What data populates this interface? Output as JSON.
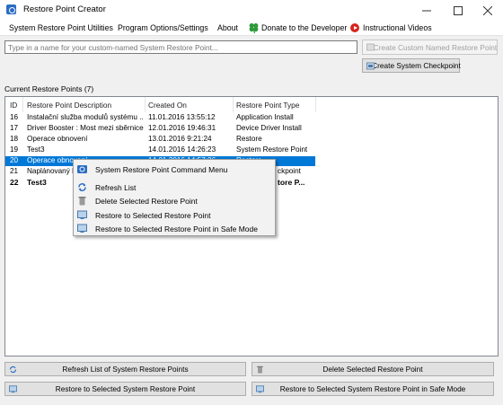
{
  "window": {
    "title": "Restore Point Creator"
  },
  "menu": {
    "utilities": "System Restore Point Utilities",
    "options": "Program Options/Settings",
    "about": "About",
    "donate": "Donate to the Developer",
    "videos": "Instructional Videos"
  },
  "name_input": {
    "placeholder": "Type in a name for your custom-named System Restore Point...",
    "value": ""
  },
  "buttons": {
    "create_custom": "Create Custom Named Restore Point",
    "create_checkpoint": "Create System Checkpoint",
    "refresh_list": "Refresh List of System Restore Points",
    "delete_selected": "Delete Selected Restore Point",
    "restore_selected": "Restore to Selected System Restore Point",
    "restore_safe_mode": "Restore to Selected System Restore Point in Safe Mode"
  },
  "list": {
    "label": "Current Restore Points (7)",
    "columns": [
      "ID",
      "Restore Point Description",
      "Created On",
      "Restore Point Type"
    ],
    "rows": [
      {
        "id": "16",
        "desc": "Instalační služba modulů systému ...",
        "created": "11.01.2016 13:55:12",
        "type": "Application Install"
      },
      {
        "id": "17",
        "desc": "Driver Booster : Most mezi sběrnice...",
        "created": "12.01.2016 19:46:31",
        "type": "Device Driver Install"
      },
      {
        "id": "18",
        "desc": "Operace obnovení",
        "created": "13.01.2016 9:21:24",
        "type": "Restore"
      },
      {
        "id": "19",
        "desc": "Test3",
        "created": "14.01.2016 14:26:23",
        "type": "System Restore Point"
      },
      {
        "id": "20",
        "desc": "Operace obnovení",
        "created": "14.01.2016 14:57:36",
        "type": "Restore"
      },
      {
        "id": "21",
        "desc": "Naplánovaný k",
        "created": "",
        "type": "ckpoint"
      },
      {
        "id": "22",
        "desc": "Test3",
        "created": "",
        "type": "tore P..."
      }
    ]
  },
  "context_menu": {
    "title": "System Restore Point Command Menu",
    "refresh": "Refresh List",
    "delete": "Delete Selected Restore Point",
    "restore": "Restore to Selected Restore Point",
    "restore_safe": "Restore to Selected Restore Point in Safe Mode"
  },
  "colors": {
    "selection": "#0078d7",
    "donate_icon": "#2e9a3c",
    "video_icon": "#d6261e"
  }
}
